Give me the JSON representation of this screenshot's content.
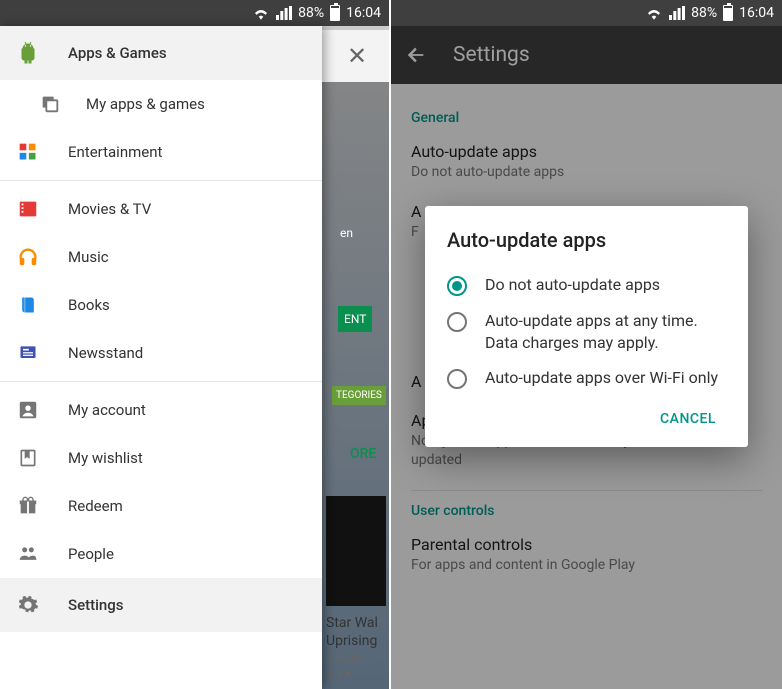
{
  "statusbar": {
    "battery_pct": "88%",
    "time": "16:04"
  },
  "left": {
    "close_glyph": "✕",
    "bg": {
      "tag_en": "en",
      "badge": "ENT",
      "categories": "TEGORIES",
      "more": "ORE",
      "card_title": "Star Wal",
      "card_sub": "Uprising",
      "card_pub": "Kabam",
      "card_rating": "4.2★"
    },
    "items": [
      {
        "id": "apps-games",
        "label": "Apps & Games",
        "active": true,
        "icon": "android"
      },
      {
        "id": "my-apps",
        "label": "My apps & games",
        "indent": true,
        "icon": "stack"
      },
      {
        "id": "entertainment",
        "label": "Entertainment",
        "icon": "tiles"
      },
      {
        "divider": true
      },
      {
        "id": "movies",
        "label": "Movies & TV",
        "icon": "film"
      },
      {
        "id": "music",
        "label": "Music",
        "icon": "headphones"
      },
      {
        "id": "books",
        "label": "Books",
        "icon": "book"
      },
      {
        "id": "newsstand",
        "label": "Newsstand",
        "icon": "news"
      },
      {
        "divider": true
      },
      {
        "id": "my-account",
        "label": "My account",
        "icon": "account"
      },
      {
        "id": "wishlist",
        "label": "My wishlist",
        "icon": "bookmark"
      },
      {
        "id": "redeem",
        "label": "Redeem",
        "icon": "gift"
      },
      {
        "id": "people",
        "label": "People",
        "icon": "people"
      },
      {
        "id": "settings",
        "label": "Settings",
        "active": true,
        "icon": "gear"
      }
    ]
  },
  "right": {
    "toolbar_title": "Settings",
    "sections": {
      "general": "General",
      "user_controls": "User controls"
    },
    "settings": {
      "auto_update_title": "Auto-update apps",
      "auto_update_sub": "Do not auto-update apps",
      "row_a_title": "A",
      "row_f_sub": "F",
      "row_a2_title": "A",
      "apps_auto_title": "Apps were auto-updated",
      "apps_auto_sub": "Notify when apps are automatically updated",
      "parental_title": "Parental controls",
      "parental_sub": "For apps and content in Google Play"
    },
    "dialog": {
      "title": "Auto-update apps",
      "options": [
        "Do not auto-update apps",
        "Auto-update apps at any time. Data charges may apply.",
        "Auto-update apps over Wi-Fi only"
      ],
      "selected_index": 0,
      "cancel": "CANCEL"
    }
  }
}
